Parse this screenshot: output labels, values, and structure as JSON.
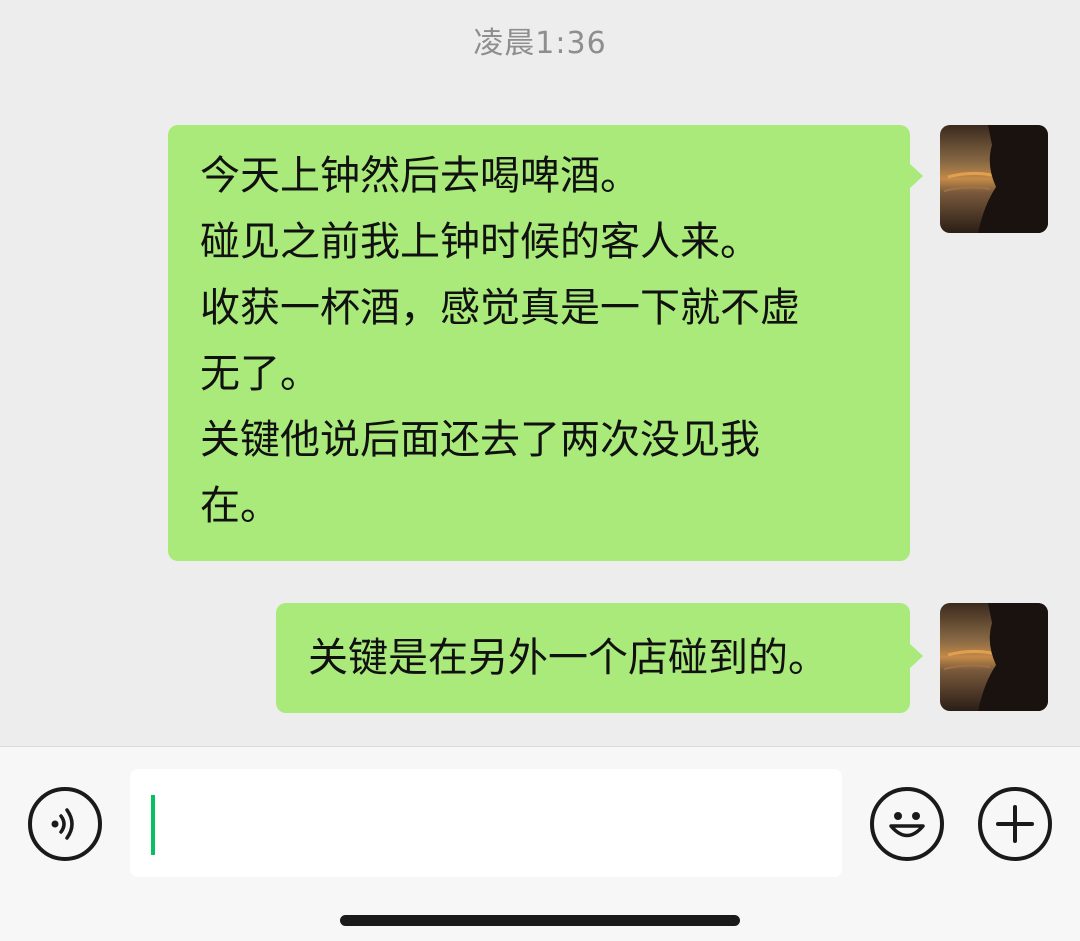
{
  "chat": {
    "timestamp": "凌晨1:36",
    "messages": [
      {
        "sender": "self",
        "lines": [
          "今天上钟然后去喝啤酒。",
          "碰见之前我上钟时候的客人来。",
          "收获一杯酒，感觉真是一下就不虚",
          "无了。",
          "关键他说后面还去了两次没见我",
          "在。"
        ]
      },
      {
        "sender": "self",
        "lines": [
          "关键是在另外一个店碰到的。"
        ]
      }
    ]
  },
  "input_bar": {
    "value": "",
    "left_icon": "voice-icon",
    "right_icons": [
      "emoji-icon",
      "plus-icon"
    ]
  },
  "colors": {
    "background": "#ededed",
    "bubble": "#a9ea7a",
    "caret": "#07c160",
    "timestamp": "#8e8e8e"
  }
}
